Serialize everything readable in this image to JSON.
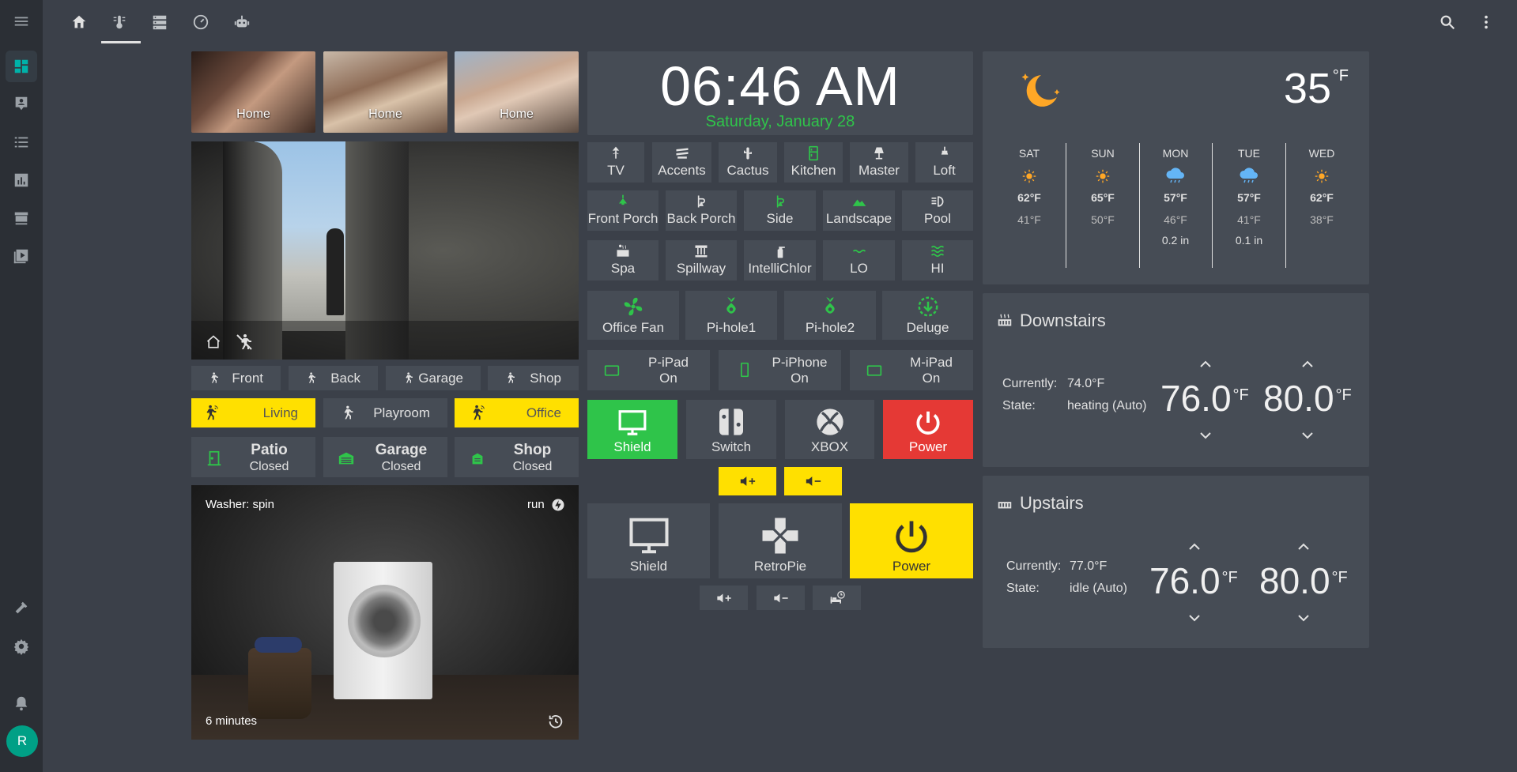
{
  "user": {
    "initial": "R"
  },
  "cameras": {
    "thumbs": [
      {
        "label": "Home"
      },
      {
        "label": "Home"
      },
      {
        "label": "Home"
      }
    ]
  },
  "motion": [
    {
      "label": "Front",
      "active": false
    },
    {
      "label": "Back",
      "active": false
    },
    {
      "label": "Garage",
      "active": false
    },
    {
      "label": "Shop",
      "active": false
    },
    {
      "label": "Living",
      "active": true
    },
    {
      "label": "Playroom",
      "active": false
    },
    {
      "label": "Office",
      "active": true
    }
  ],
  "doors": [
    {
      "name": "Patio",
      "state": "Closed"
    },
    {
      "name": "Garage",
      "state": "Closed"
    },
    {
      "name": "Shop",
      "state": "Closed"
    }
  ],
  "washer": {
    "status": "Washer: spin",
    "mode": "run",
    "remaining": "6 minutes"
  },
  "clock": {
    "time": "06:46 AM",
    "date": "Saturday, January 28"
  },
  "lights_row1": [
    "TV",
    "Accents",
    "Cactus",
    "Kitchen",
    "Master",
    "Loft"
  ],
  "lights_row2": [
    "Front Porch",
    "Back Porch",
    "Side",
    "Landscape",
    "Pool"
  ],
  "pool_row": [
    "Spa",
    "Spillway",
    "IntelliChlor",
    "LO",
    "HI"
  ],
  "switch_row": [
    "Office Fan",
    "Pi-hole1",
    "Pi-hole2",
    "Deluge"
  ],
  "devices": [
    {
      "name": "P-iPad",
      "state": "On"
    },
    {
      "name": "P-iPhone",
      "state": "On"
    },
    {
      "name": "M-iPad",
      "state": "On"
    }
  ],
  "media_row1": [
    "Shield",
    "Switch",
    "XBOX",
    "Power"
  ],
  "media_row2": [
    "Shield",
    "RetroPie",
    "Power"
  ],
  "weather": {
    "current_temp": "35",
    "unit": "°F",
    "forecast": [
      {
        "day": "SAT",
        "icon": "sunny-icon",
        "high": "62°F",
        "low": "41°F",
        "precip": ""
      },
      {
        "day": "SUN",
        "icon": "sunny-icon",
        "high": "65°F",
        "low": "50°F",
        "precip": ""
      },
      {
        "day": "MON",
        "icon": "rainy-icon",
        "high": "57°F",
        "low": "46°F",
        "precip": "0.2 in"
      },
      {
        "day": "TUE",
        "icon": "rainy-icon",
        "high": "57°F",
        "low": "41°F",
        "precip": "0.1 in"
      },
      {
        "day": "WED",
        "icon": "sunny-icon",
        "high": "62°F",
        "low": "38°F",
        "precip": ""
      }
    ]
  },
  "thermostats": [
    {
      "name": "Downstairs",
      "currently_label": "Currently:",
      "currently": "74.0°F",
      "state_label": "State:",
      "state": "heating (Auto)",
      "low": "76.0",
      "high": "80.0",
      "unit": "°F"
    },
    {
      "name": "Upstairs",
      "currently_label": "Currently:",
      "currently": "77.0°F",
      "state_label": "State:",
      "state": "idle (Auto)",
      "low": "76.0",
      "high": "80.0",
      "unit": "°F"
    }
  ],
  "colors": {
    "accent": "#2fc44a",
    "yellow": "#ffe000",
    "red": "#e53935",
    "card": "#464c55",
    "bg": "#3b4049",
    "sidebar": "#2b2f35",
    "date": "#2fc44a",
    "moon": "#ffa726"
  }
}
